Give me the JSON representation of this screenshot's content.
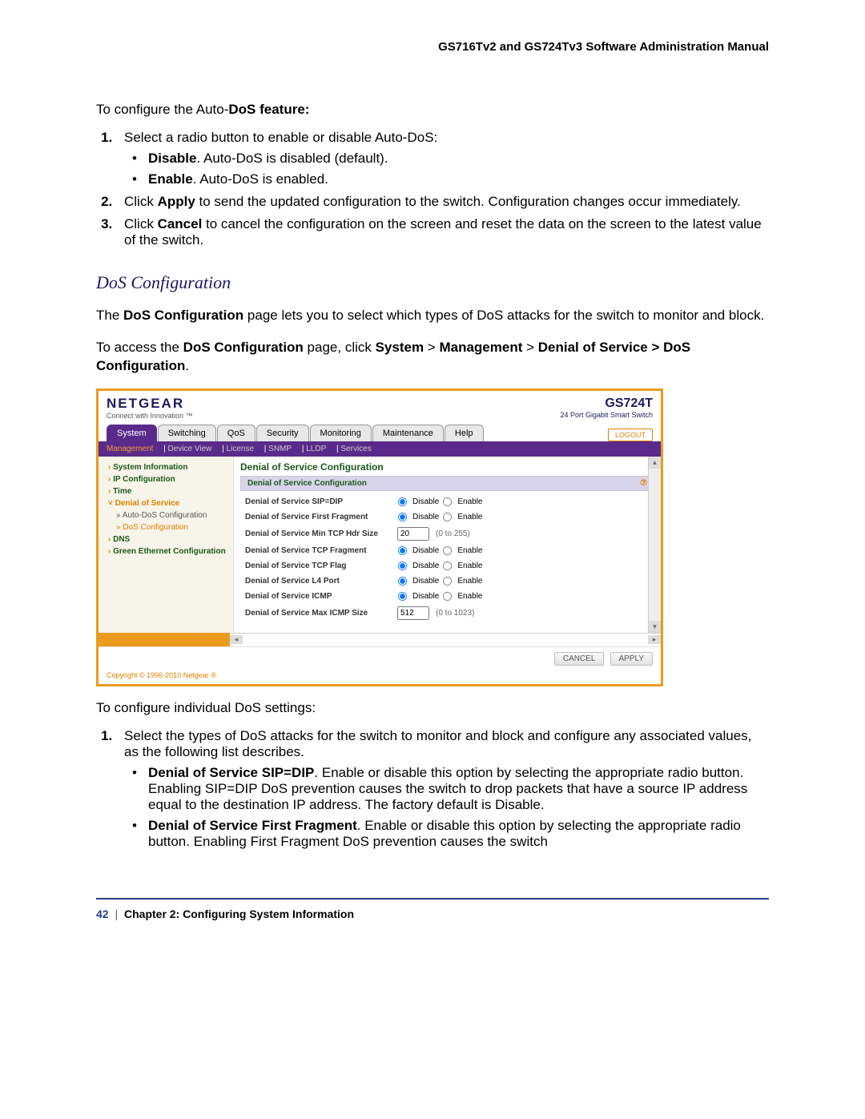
{
  "header": {
    "manual_title": "GS716Tv2 and GS724Tv3 Software Administration Manual"
  },
  "intro": {
    "configure_line_prefix": "To configure the Auto-",
    "configure_line_bold": "DoS feature:"
  },
  "steps_a": {
    "s1": "Select a radio button to enable or disable Auto-DoS:",
    "s1_b1_bold": "Disable",
    "s1_b1_rest": ". Auto-DoS is disabled (default).",
    "s1_b2_bold": "Enable",
    "s1_b2_rest": ". Auto-DoS is enabled.",
    "s2_pre": "Click ",
    "s2_bold": "Apply",
    "s2_post": " to send the updated configuration to the switch. Configuration changes occur immediately.",
    "s3_pre": "Click ",
    "s3_bold": "Cancel",
    "s3_post": " to cancel the configuration on the screen and reset the data on the screen to the latest value of the switch."
  },
  "section_heading": "DoS Configuration",
  "para1_pre": "The ",
  "para1_bold": "DoS Configuration",
  "para1_post": " page lets you to select which types of DoS attacks for the switch to monitor and block.",
  "para2_pre": "To access the ",
  "para2_b1": "DoS Configuration",
  "para2_mid1": " page, click ",
  "para2_b2": "System",
  "para2_gt": " > ",
  "para2_b3": "Management",
  "para2_b4": "Denial of Service > DoS Configuration",
  "screenshot": {
    "brand": "NETGEAR",
    "tagline": "Connect with Innovation ™",
    "model": "GS724T",
    "model_sub": "24 Port Gigabit Smart Switch",
    "tabs": [
      "System",
      "Switching",
      "QoS",
      "Security",
      "Monitoring",
      "Maintenance",
      "Help"
    ],
    "logout": "LOGOUT",
    "subnav": [
      "Management",
      "Device View",
      "License",
      "SNMP",
      "LLDP",
      "Services"
    ],
    "sidebar": {
      "i0": "System Information",
      "i1": "IP Configuration",
      "i2": "Time",
      "i3": "Denial of Service",
      "i3a": "Auto-DoS Configuration",
      "i3b": "DoS Configuration",
      "i4": "DNS",
      "i5": "Green Ethernet Configuration"
    },
    "main_title": "Denial of Service Configuration",
    "panel_title": "Denial of Service Configuration",
    "rows": {
      "r1": "Denial of Service SIP=DIP",
      "r2": "Denial of Service First Fragment",
      "r3": "Denial of Service Min TCP Hdr Size",
      "r3_val": "20",
      "r3_range": "(0 to 255)",
      "r4": "Denial of Service TCP Fragment",
      "r5": "Denial of Service TCP Flag",
      "r6": "Denial of Service L4 Port",
      "r7": "Denial of Service ICMP",
      "r8": "Denial of Service Max ICMP Size",
      "r8_val": "512",
      "r8_range": "(0 to 1023)",
      "opt_disable": "Disable",
      "opt_enable": "Enable"
    },
    "btn_cancel": "CANCEL",
    "btn_apply": "APPLY",
    "copyright": "Copyright © 1996-2010 Netgear ®"
  },
  "post_intro": "To configure individual DoS settings:",
  "steps_b": {
    "s1": "Select the types of DoS attacks for the switch to monitor and block and configure any associated values, as the following list describes.",
    "b1_bold": "Denial of Service SIP=DIP",
    "b1_rest": ". Enable or disable this option by selecting the appropriate radio button. Enabling SIP=DIP DoS prevention causes the switch to drop packets that have a source IP address equal to the destination IP address. The factory default is Disable.",
    "b2_bold": "Denial of Service First Fragment",
    "b2_rest": ". Enable or disable this option by selecting the appropriate radio button. Enabling First Fragment DoS prevention causes the switch"
  },
  "footer": {
    "page_num": "42",
    "sep": "|",
    "chapter": "Chapter 2:  Configuring System Information"
  }
}
